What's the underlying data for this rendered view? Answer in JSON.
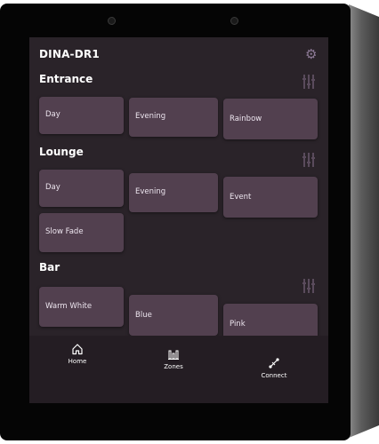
{
  "header": {
    "title": "DINA-DR1",
    "settings_icon": "gear-icon"
  },
  "zones": [
    {
      "name": "Entrance",
      "scenes": [
        "Day",
        "Evening",
        "Rainbow"
      ]
    },
    {
      "name": "Lounge",
      "scenes": [
        "Day",
        "Evening",
        "Event",
        "Slow Fade"
      ]
    },
    {
      "name": "Bar",
      "scenes": [
        "Warm White",
        "Blue",
        "Pink"
      ]
    }
  ],
  "nav": [
    {
      "label": "Home",
      "icon": "home-icon"
    },
    {
      "label": "Zones",
      "icon": "zones-icon"
    },
    {
      "label": "Connect",
      "icon": "connect-icon"
    }
  ],
  "colors": {
    "background": "#2a2329",
    "tile": "#52404f",
    "accent": "#8d7a96",
    "text": "#ffffff"
  }
}
